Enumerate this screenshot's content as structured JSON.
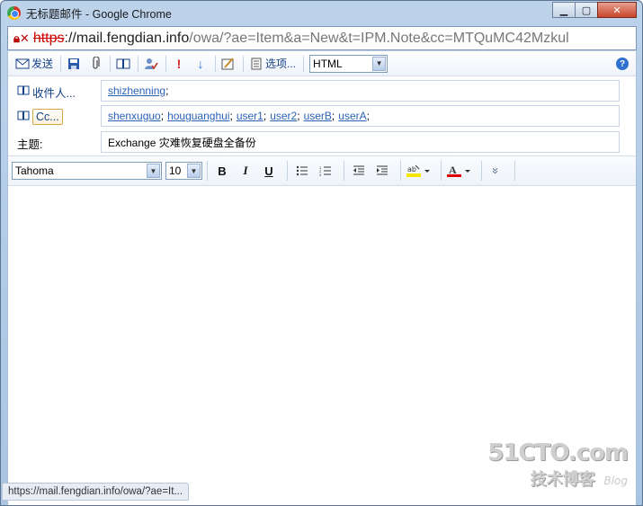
{
  "window": {
    "title": "无标题邮件 - Google Chrome",
    "controls": {
      "minimize": "▁",
      "maximize": "▢",
      "close": "✕"
    }
  },
  "address": {
    "scheme": "https",
    "host": "://mail.fengdian.info",
    "path": "/owa/?ae=Item&a=New&t=IPM.Note&cc=MTQuMC42Mzkul"
  },
  "toolbar": {
    "send_label": "发送",
    "options_label": "选项...",
    "format_select": "HTML",
    "icons": [
      "send-icon",
      "save-icon",
      "attach-icon",
      "address-book-icon",
      "check-names-icon",
      "high-importance-icon",
      "low-importance-icon",
      "signature-icon",
      "options-icon",
      "help-icon"
    ]
  },
  "compose": {
    "to_label": "收件人...",
    "to_recipients": [
      "shizhenning"
    ],
    "cc_label": "Cc...",
    "cc_recipients": [
      "shenxuguo",
      "houguanghui",
      "user1",
      "user2",
      "userB",
      "userA"
    ],
    "subject_label": "主题:",
    "subject_value": "Exchange 灾难恢复硬盘全备份"
  },
  "format": {
    "font_family": "Tahoma",
    "font_size": "10",
    "bold": "B",
    "italic": "I",
    "underline": "U",
    "expand": "»"
  },
  "status": {
    "url": "https://mail.fengdian.info/owa/?ae=It..."
  },
  "watermark": {
    "brand": "51CTO.com",
    "sub": "技术博客",
    "blog": "Blog"
  },
  "colors": {
    "link": "#2a62b7",
    "label": "#15428b",
    "highlight": "#f5e600",
    "font_color": "#e00000"
  }
}
